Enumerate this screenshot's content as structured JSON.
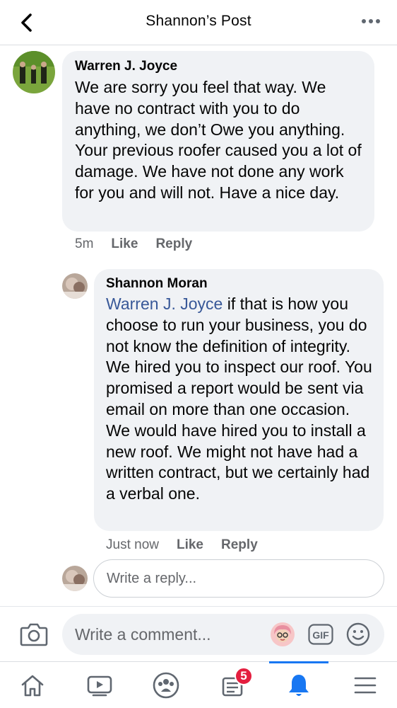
{
  "header": {
    "title": "Shannon’s Post",
    "back_icon": "chevron-left-icon",
    "more_icon": "more-horizontal-icon"
  },
  "comments": [
    {
      "author": "Warren J. Joyce",
      "text": "We are sorry you feel that way. We have no contract with you to do anything, we don’t Owe you anything. Your previous roofer caused you a lot of damage. We have not done any work for you and will not. Have a nice day.",
      "time": "5m",
      "like_label": "Like",
      "reply_label": "Reply"
    },
    {
      "author": "Shannon Moran",
      "mention": "Warren J. Joyce",
      "text": " if that is how you choose to run your business, you do not know the definition of integrity. We hired you to inspect our roof. You promised a report would be sent via email on more than one occasion. We would have hired you to install a new roof. We might not have had a written contract, but we certainly had a verbal one.",
      "time": "Just now",
      "like_label": "Like",
      "reply_label": "Reply"
    }
  ],
  "reply_box": {
    "placeholder": "Write a reply..."
  },
  "composer": {
    "placeholder": "Write a comment...",
    "camera_icon": "camera-icon",
    "avatar_icon": "avatar-sticker-icon",
    "gif_label": "GIF",
    "emoji_icon": "emoji-icon"
  },
  "nav": {
    "items": [
      {
        "name": "home",
        "icon": "home-icon"
      },
      {
        "name": "watch",
        "icon": "video-icon"
      },
      {
        "name": "groups",
        "icon": "groups-icon"
      },
      {
        "name": "news",
        "icon": "news-feed-icon",
        "badge": "5"
      },
      {
        "name": "notifications",
        "icon": "bell-icon",
        "active": true
      },
      {
        "name": "menu",
        "icon": "menu-icon"
      }
    ]
  },
  "colors": {
    "link": "#385898",
    "accent": "#1877f2",
    "bubble": "#f0f2f5",
    "badge": "#e41e3f",
    "meta_text": "#65676b"
  }
}
